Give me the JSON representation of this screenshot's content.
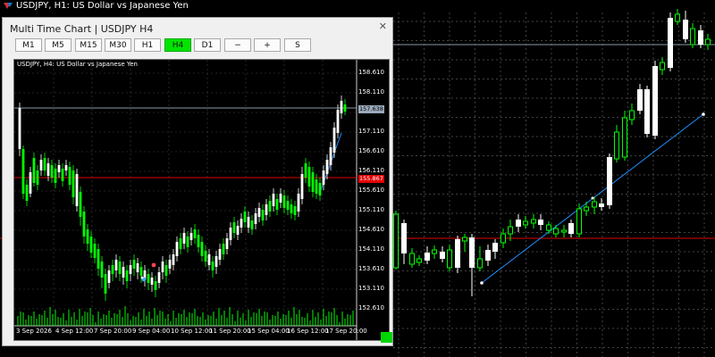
{
  "main_window": {
    "title": "USDJPY, H1:  US Dollar vs Japanese Yen"
  },
  "mtc_window": {
    "title": "Multi Time Chart  |  USDJPY H4",
    "close_label": "✕",
    "buttons": [
      {
        "label": "M1",
        "active": false
      },
      {
        "label": "M5",
        "active": false
      },
      {
        "label": "M15",
        "active": false
      },
      {
        "label": "M30",
        "active": false
      },
      {
        "label": "H1",
        "active": false
      },
      {
        "label": "H4",
        "active": true
      },
      {
        "label": "D1",
        "active": false
      },
      {
        "label": "−",
        "active": false
      },
      {
        "label": "+",
        "active": false
      },
      {
        "label": "S",
        "active": false
      }
    ],
    "active_color": "#00e400"
  },
  "sub_chart": {
    "title": "USDJPY, H4:  US Dollar vs Japanese Yen",
    "y_ticks": [
      "158.610",
      "158.110",
      "157.610",
      "157.110",
      "156.610",
      "156.110",
      "155.610",
      "155.110",
      "154.610",
      "154.110",
      "153.610",
      "153.110",
      "152.610"
    ],
    "x_ticks": [
      "3 Sep 2026",
      "4 Sep 12:00",
      "7 Sep 20:00",
      "9 Sep 04:00",
      "10 Sep 12:00",
      "11 Sep 20:00",
      "15 Sep 04:00",
      "16 Sep 12:00",
      "17 Sep 20:00"
    ],
    "current_price": "157.638",
    "level_price": "155.867",
    "colors": {
      "up": "#ffffff",
      "down": "#00ff00",
      "level_line": "#e00000",
      "trend_line": "#1e90ff"
    }
  }
}
